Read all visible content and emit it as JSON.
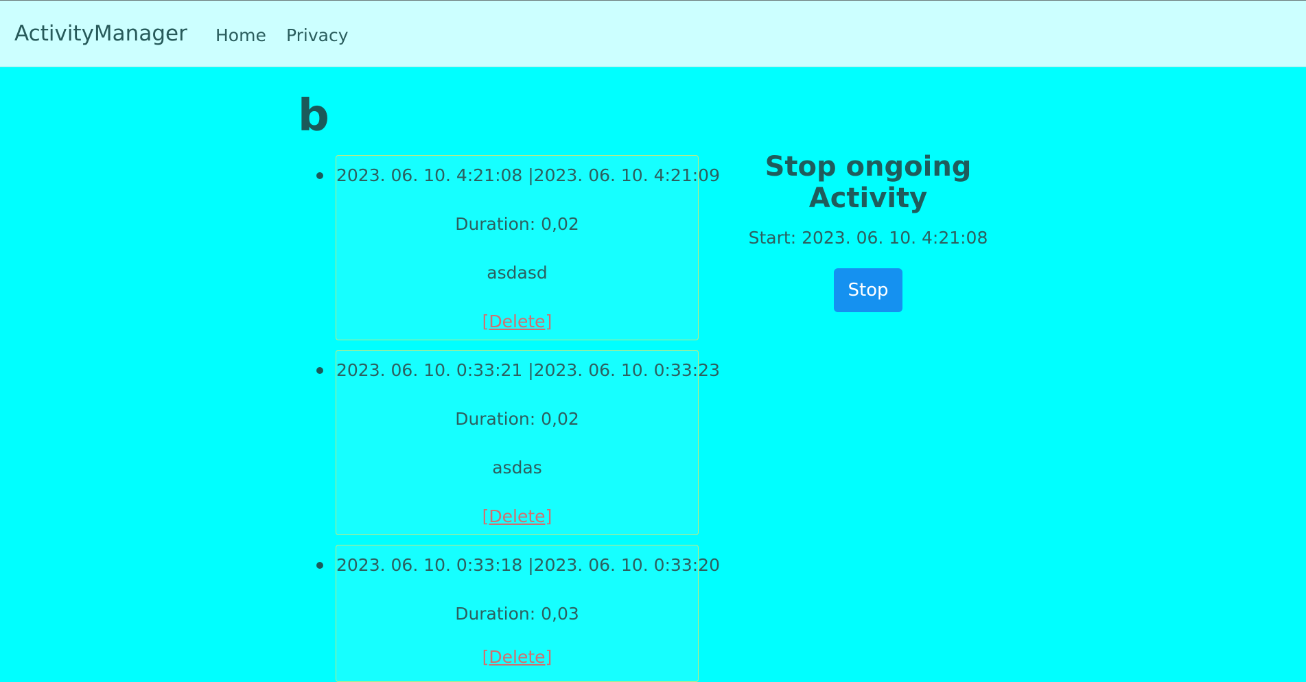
{
  "nav": {
    "brand": "ActivityManager",
    "links": [
      "Home",
      "Privacy"
    ]
  },
  "page": {
    "title": "b"
  },
  "activities": [
    {
      "range": "2023. 06. 10. 4:21:08 |2023. 06. 10. 4:21:09",
      "duration": "Duration: 0,02",
      "name": "asdasd",
      "delete": "[Delete]"
    },
    {
      "range": "2023. 06. 10. 0:33:21 |2023. 06. 10. 0:33:23",
      "duration": "Duration: 0,02",
      "name": "asdas",
      "delete": "[Delete]"
    },
    {
      "range": "2023. 06. 10. 0:33:18 |2023. 06. 10. 0:33:20",
      "duration": "Duration: 0,03",
      "name": "",
      "delete": "[Delete]"
    }
  ],
  "stop_panel": {
    "heading": "Stop ongoing Activity",
    "start": "Start: 2023. 06. 10. 4:21:08",
    "button_label": "Stop"
  },
  "colors": {
    "page_bg": "#00ffff",
    "navbar_bg": "#ccffff",
    "button_bg": "#1591f0",
    "delete_link": "#d07070"
  }
}
